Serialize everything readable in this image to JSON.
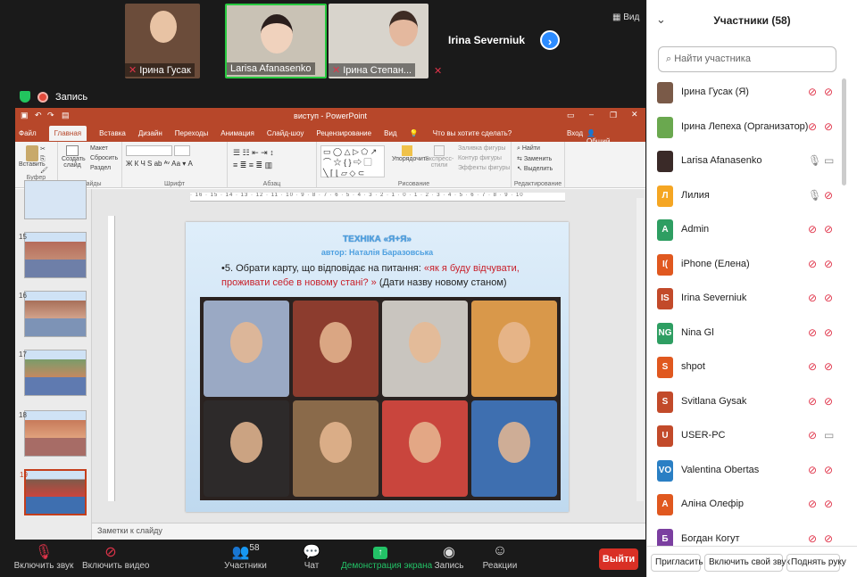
{
  "left_edge": "Вс",
  "video_strip": {
    "tiles": [
      {
        "name": "Ірина Гусак",
        "muted": true,
        "bg": "#6b4c3a"
      },
      {
        "name": "Larisa Afanasenko",
        "muted": false,
        "bg": "#c9c2b5"
      },
      {
        "name": "Ірина Степан...",
        "muted": true,
        "bg": "#d8d4cc"
      }
    ],
    "name_only_tile": "Irina Severniuk",
    "view_label": "Вид",
    "next_icon": "chevron-right-icon"
  },
  "recording": {
    "label": "Запись"
  },
  "powerpoint": {
    "title": "виступ - PowerPoint",
    "tabs": [
      "Файл",
      "Главная",
      "Вставка",
      "Дизайн",
      "Переходы",
      "Анимация",
      "Слайд-шоу",
      "Рецензирование",
      "Вид"
    ],
    "active_tab": "Главная",
    "tell_me": "Что вы хотите сделать?",
    "login": "Вход",
    "share": "Общий доступ",
    "ribbon_groups": {
      "clipboard": {
        "label": "Буфер обмена",
        "paste": "Вставить"
      },
      "slides": {
        "label": "Слайды",
        "new_slide": "Создать слайд",
        "layout": "Макет",
        "reset": "Сбросить",
        "section": "Раздел"
      },
      "font": {
        "label": "Шрифт"
      },
      "paragraph": {
        "label": "Абзац"
      },
      "drawing": {
        "label": "Рисование",
        "arrange": "Упорядочить",
        "quick_styles": "Экспресс-стили",
        "fill": "Заливка фигуры",
        "outline": "Контур фигуры",
        "effects": "Эффекты фигуры"
      },
      "editing": {
        "label": "Редактирование",
        "find": "Найти",
        "replace": "Заменить",
        "select": "Выделить"
      }
    },
    "thumbnails": [
      15,
      16,
      17,
      18,
      19
    ],
    "selected_slide": 19,
    "slide": {
      "title": "ТЕХНІКА «Я+Я»",
      "author": "автор: Наталія Баразовська",
      "question_black": "•5. Обрати карту, що відповідає на питання: ",
      "question_red": "«як я буду відчувати, проживати себе в новому стані? »",
      "question_tail": " (Дати назву новому станом)",
      "portrait_colors": [
        "#9aa9c4",
        "#8c3c2e",
        "#c9c5bf",
        "#d9984a",
        "#2d2a2a",
        "#8a6a4a",
        "#c9453d",
        "#3e6fb0"
      ]
    },
    "notes_placeholder": "Заметки к слайду"
  },
  "toolbar": {
    "mic": "Включить звук",
    "video": "Включить видео",
    "participants": "Участники",
    "participants_count": "58",
    "chat": "Чат",
    "share": "Демонстрация экрана",
    "record": "Запись",
    "reactions": "Реакции",
    "leave": "Выйти"
  },
  "panel": {
    "title": "Участники (58)",
    "search_placeholder": "Найти участника",
    "participants": [
      {
        "name": "Ірина Гусак (Я)",
        "initials": "",
        "color": "#7a5a48",
        "mic": "off",
        "cam": "off"
      },
      {
        "name": "Ірина Лепеха (Организатор)",
        "initials": "",
        "color": "#6aa84f",
        "mic": "off",
        "cam": "off"
      },
      {
        "name": "Larisa Afanasenko",
        "initials": "",
        "color": "#3a2a28",
        "mic": "on",
        "cam": "on"
      },
      {
        "name": "Лилия",
        "initials": "Л",
        "color": "#f5a623",
        "mic": "on",
        "cam": "off"
      },
      {
        "name": "Admin",
        "initials": "A",
        "color": "#2e9e62",
        "mic": "off",
        "cam": "off"
      },
      {
        "name": "iPhone (Елена)",
        "initials": "I(",
        "color": "#e0581f",
        "mic": "off",
        "cam": "off"
      },
      {
        "name": "Irina Severniuk",
        "initials": "IS",
        "color": "#c24a2a",
        "mic": "off",
        "cam": "off"
      },
      {
        "name": "Nina Gl",
        "initials": "NG",
        "color": "#2e9e62",
        "mic": "off",
        "cam": "off"
      },
      {
        "name": "shpot",
        "initials": "S",
        "color": "#e0581f",
        "mic": "off",
        "cam": "off"
      },
      {
        "name": "Svitlana Gysak",
        "initials": "S",
        "color": "#c24a2a",
        "mic": "off",
        "cam": "off"
      },
      {
        "name": "USER-PC",
        "initials": "U",
        "color": "#c24a2a",
        "mic": "off",
        "cam": "on"
      },
      {
        "name": "Valentina Obertas",
        "initials": "VO",
        "color": "#2a7fc4",
        "mic": "off",
        "cam": "off"
      },
      {
        "name": "Аліна Олефір",
        "initials": "A",
        "color": "#e0581f",
        "mic": "off",
        "cam": "off"
      },
      {
        "name": "Богдан Когут",
        "initials": "Б",
        "color": "#7b3fa0",
        "mic": "off",
        "cam": "off"
      }
    ],
    "footer": {
      "invite": "Пригласить",
      "unmute": "Включить свой звук",
      "raise": "Поднять руку"
    }
  }
}
